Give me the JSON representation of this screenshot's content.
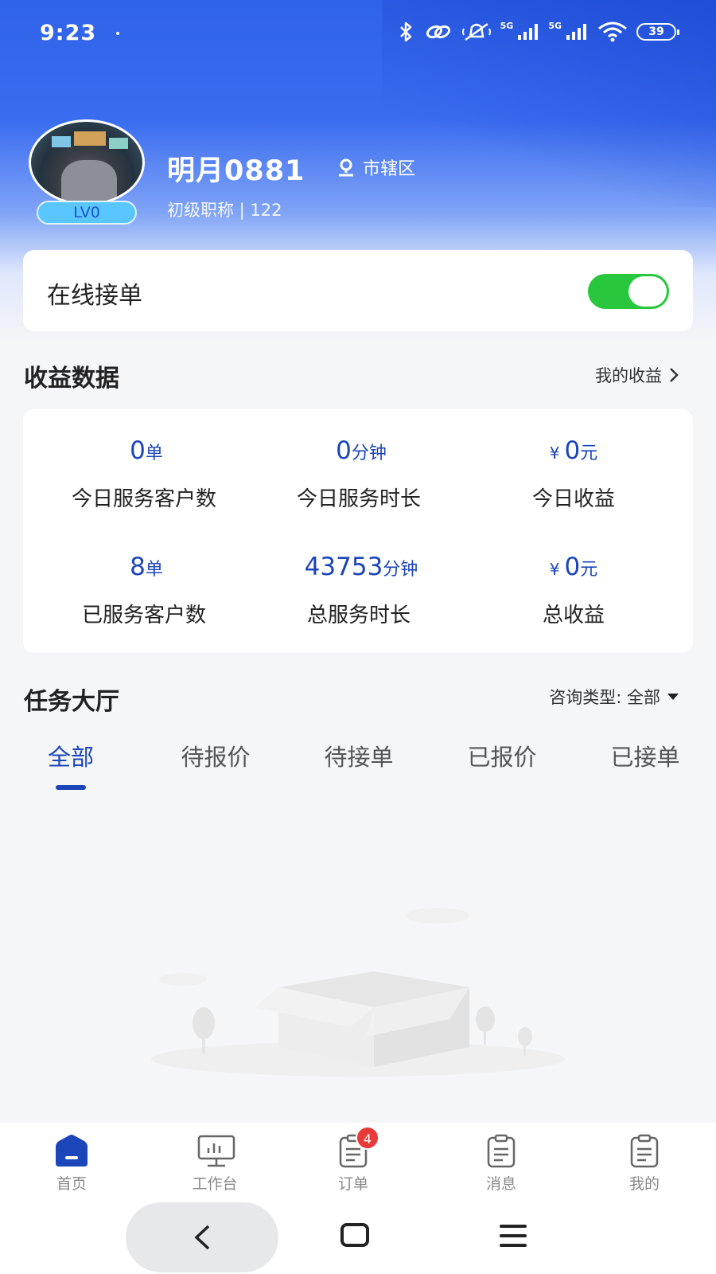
{
  "status_bar": {
    "time": "9:23",
    "battery": "39",
    "signal1": "5G",
    "signal2": "5G",
    "wifi_sub": "6"
  },
  "profile": {
    "name": "明月0881",
    "location": "市辖区",
    "subtitle": "初级职称 | 122",
    "level": "LV0"
  },
  "online": {
    "label": "在线接单",
    "enabled": true,
    "toggle_color": "#29c73e"
  },
  "earnings": {
    "title": "收益数据",
    "link": "我的收益",
    "stats": [
      {
        "value": "0",
        "unit": "单",
        "label": "今日服务客户数",
        "prefix": ""
      },
      {
        "value": "0",
        "unit": "分钟",
        "label": "今日服务时长",
        "prefix": ""
      },
      {
        "value": "0",
        "unit": "元",
        "label": "今日收益",
        "prefix": "¥"
      },
      {
        "value": "8",
        "unit": "单",
        "label": "已服务客户数",
        "prefix": ""
      },
      {
        "value": "43753",
        "unit": "分钟",
        "label": "总服务时长",
        "prefix": ""
      },
      {
        "value": "0",
        "unit": "元",
        "label": "总收益",
        "prefix": "¥"
      }
    ]
  },
  "task_hall": {
    "title": "任务大厅",
    "filter": "咨询类型: 全部",
    "tabs": [
      "全部",
      "待报价",
      "待接单",
      "已报价",
      "已接单"
    ],
    "active_tab": 0
  },
  "bottom_nav": {
    "items": [
      {
        "label": "首页",
        "icon": "home-icon"
      },
      {
        "label": "工作台",
        "icon": "monitor-icon"
      },
      {
        "label": "订单",
        "icon": "clipboard-icon",
        "badge": "4"
      },
      {
        "label": "消息",
        "icon": "clipboard-icon"
      },
      {
        "label": "我的",
        "icon": "clipboard-icon"
      }
    ],
    "active_color": "#1b45b8",
    "badge_color": "#e93a3a"
  },
  "colors": {
    "primary": "#1b45b8",
    "header_gradient_top": "#2f63e8"
  }
}
